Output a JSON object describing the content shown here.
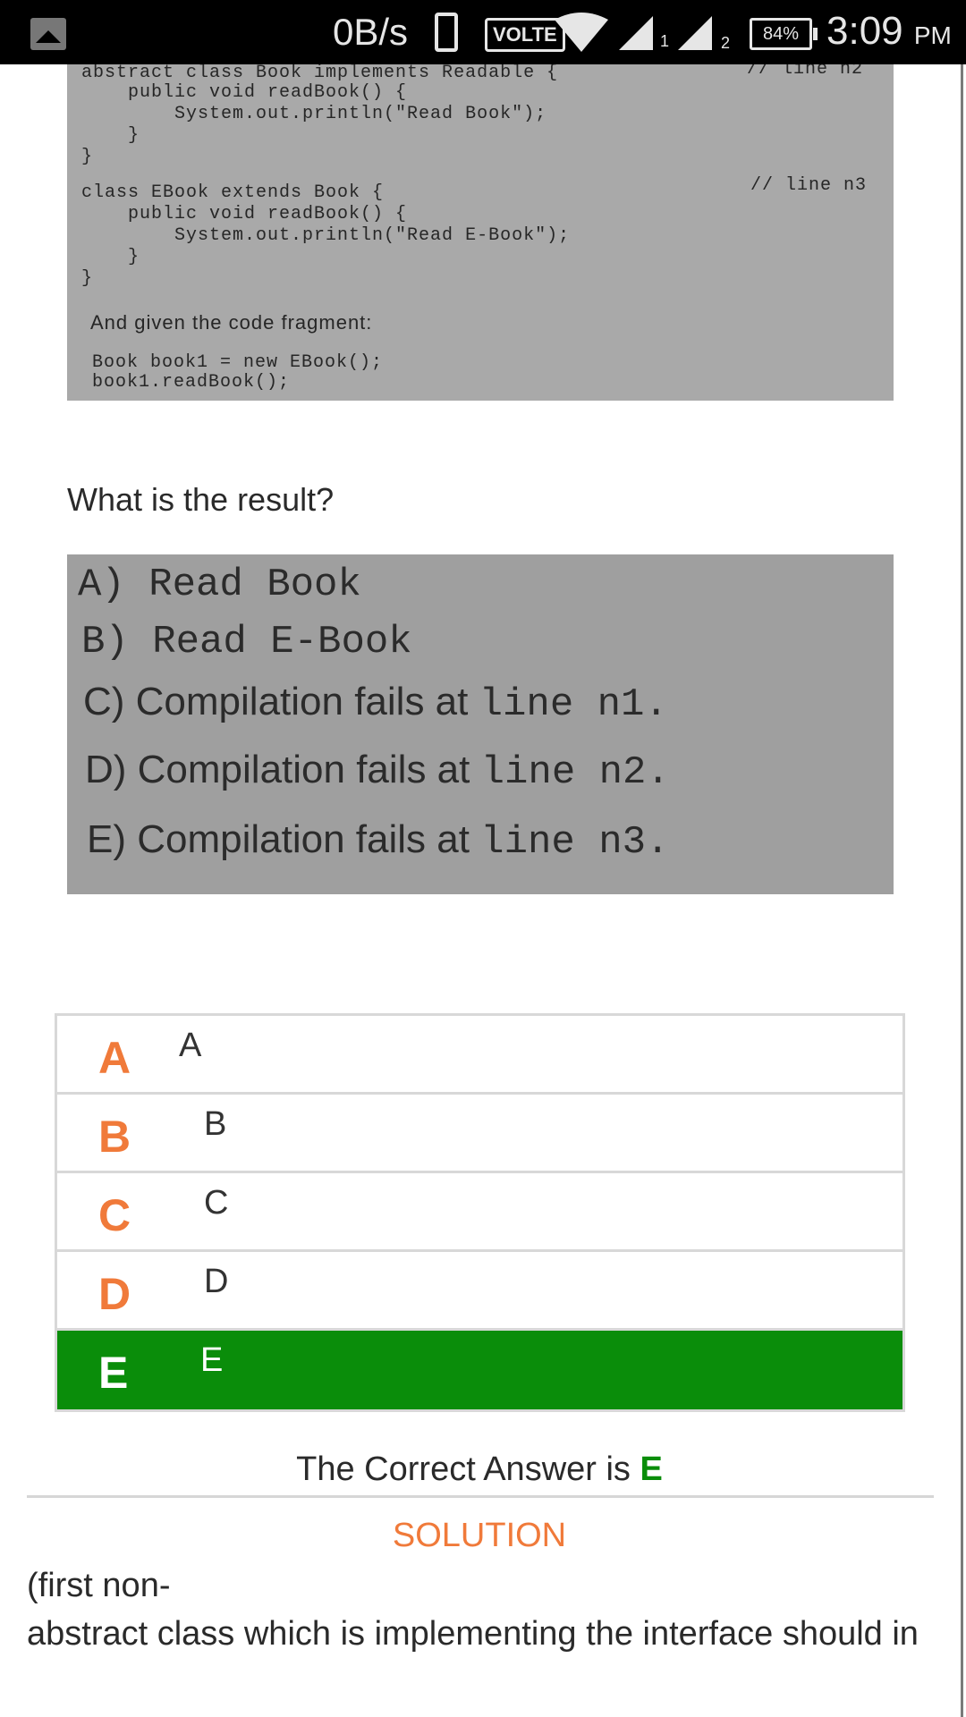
{
  "status_bar": {
    "net_speed": "0B/s",
    "volte": "VOLTE",
    "sim1": "1",
    "sim2": "2",
    "battery": "84%",
    "time": "3:09",
    "ampm": "PM"
  },
  "code_image": {
    "lines": [
      "abstract class Book implements Readable {",
      "    public void readBook() {",
      "        System.out.println(\"Read Book\");",
      "    }",
      "}",
      "class EBook extends Book {",
      "    public void readBook() {",
      "        System.out.println(\"Read E-Book\");",
      "    }",
      "}"
    ],
    "comment_n2": "// line n2",
    "comment_n3": "// line n3",
    "fragment_intro": "And given the code fragment:",
    "fragment_lines": [
      "Book book1 = new EBook();",
      "book1.readBook();"
    ]
  },
  "question": "What is the result?",
  "options_image": {
    "a": "A) Read Book",
    "b": "B) Read E-Book",
    "c_prefix": "C) Compilation fails at ",
    "c_mono": "line n1.",
    "d_prefix": "D) Compilation fails at ",
    "d_mono": "line n2.",
    "e_prefix": "E) Compilation fails at ",
    "e_mono": "line n3."
  },
  "answers": [
    {
      "letter": "A",
      "text": "A"
    },
    {
      "letter": "B",
      "text": "B"
    },
    {
      "letter": "C",
      "text": "C"
    },
    {
      "letter": "D",
      "text": "D"
    },
    {
      "letter": "E",
      "text": "E"
    }
  ],
  "selected_answer": "E",
  "correct_prefix": "The Correct Answer is ",
  "correct_letter": "E",
  "solution_title": "SOLUTION",
  "solution_lines": [
    "(first non-",
    "abstract class which is implementing  the interface should in"
  ],
  "colors": {
    "accent_orange": "#f07a3a",
    "correct_green": "#0a8d0a"
  }
}
